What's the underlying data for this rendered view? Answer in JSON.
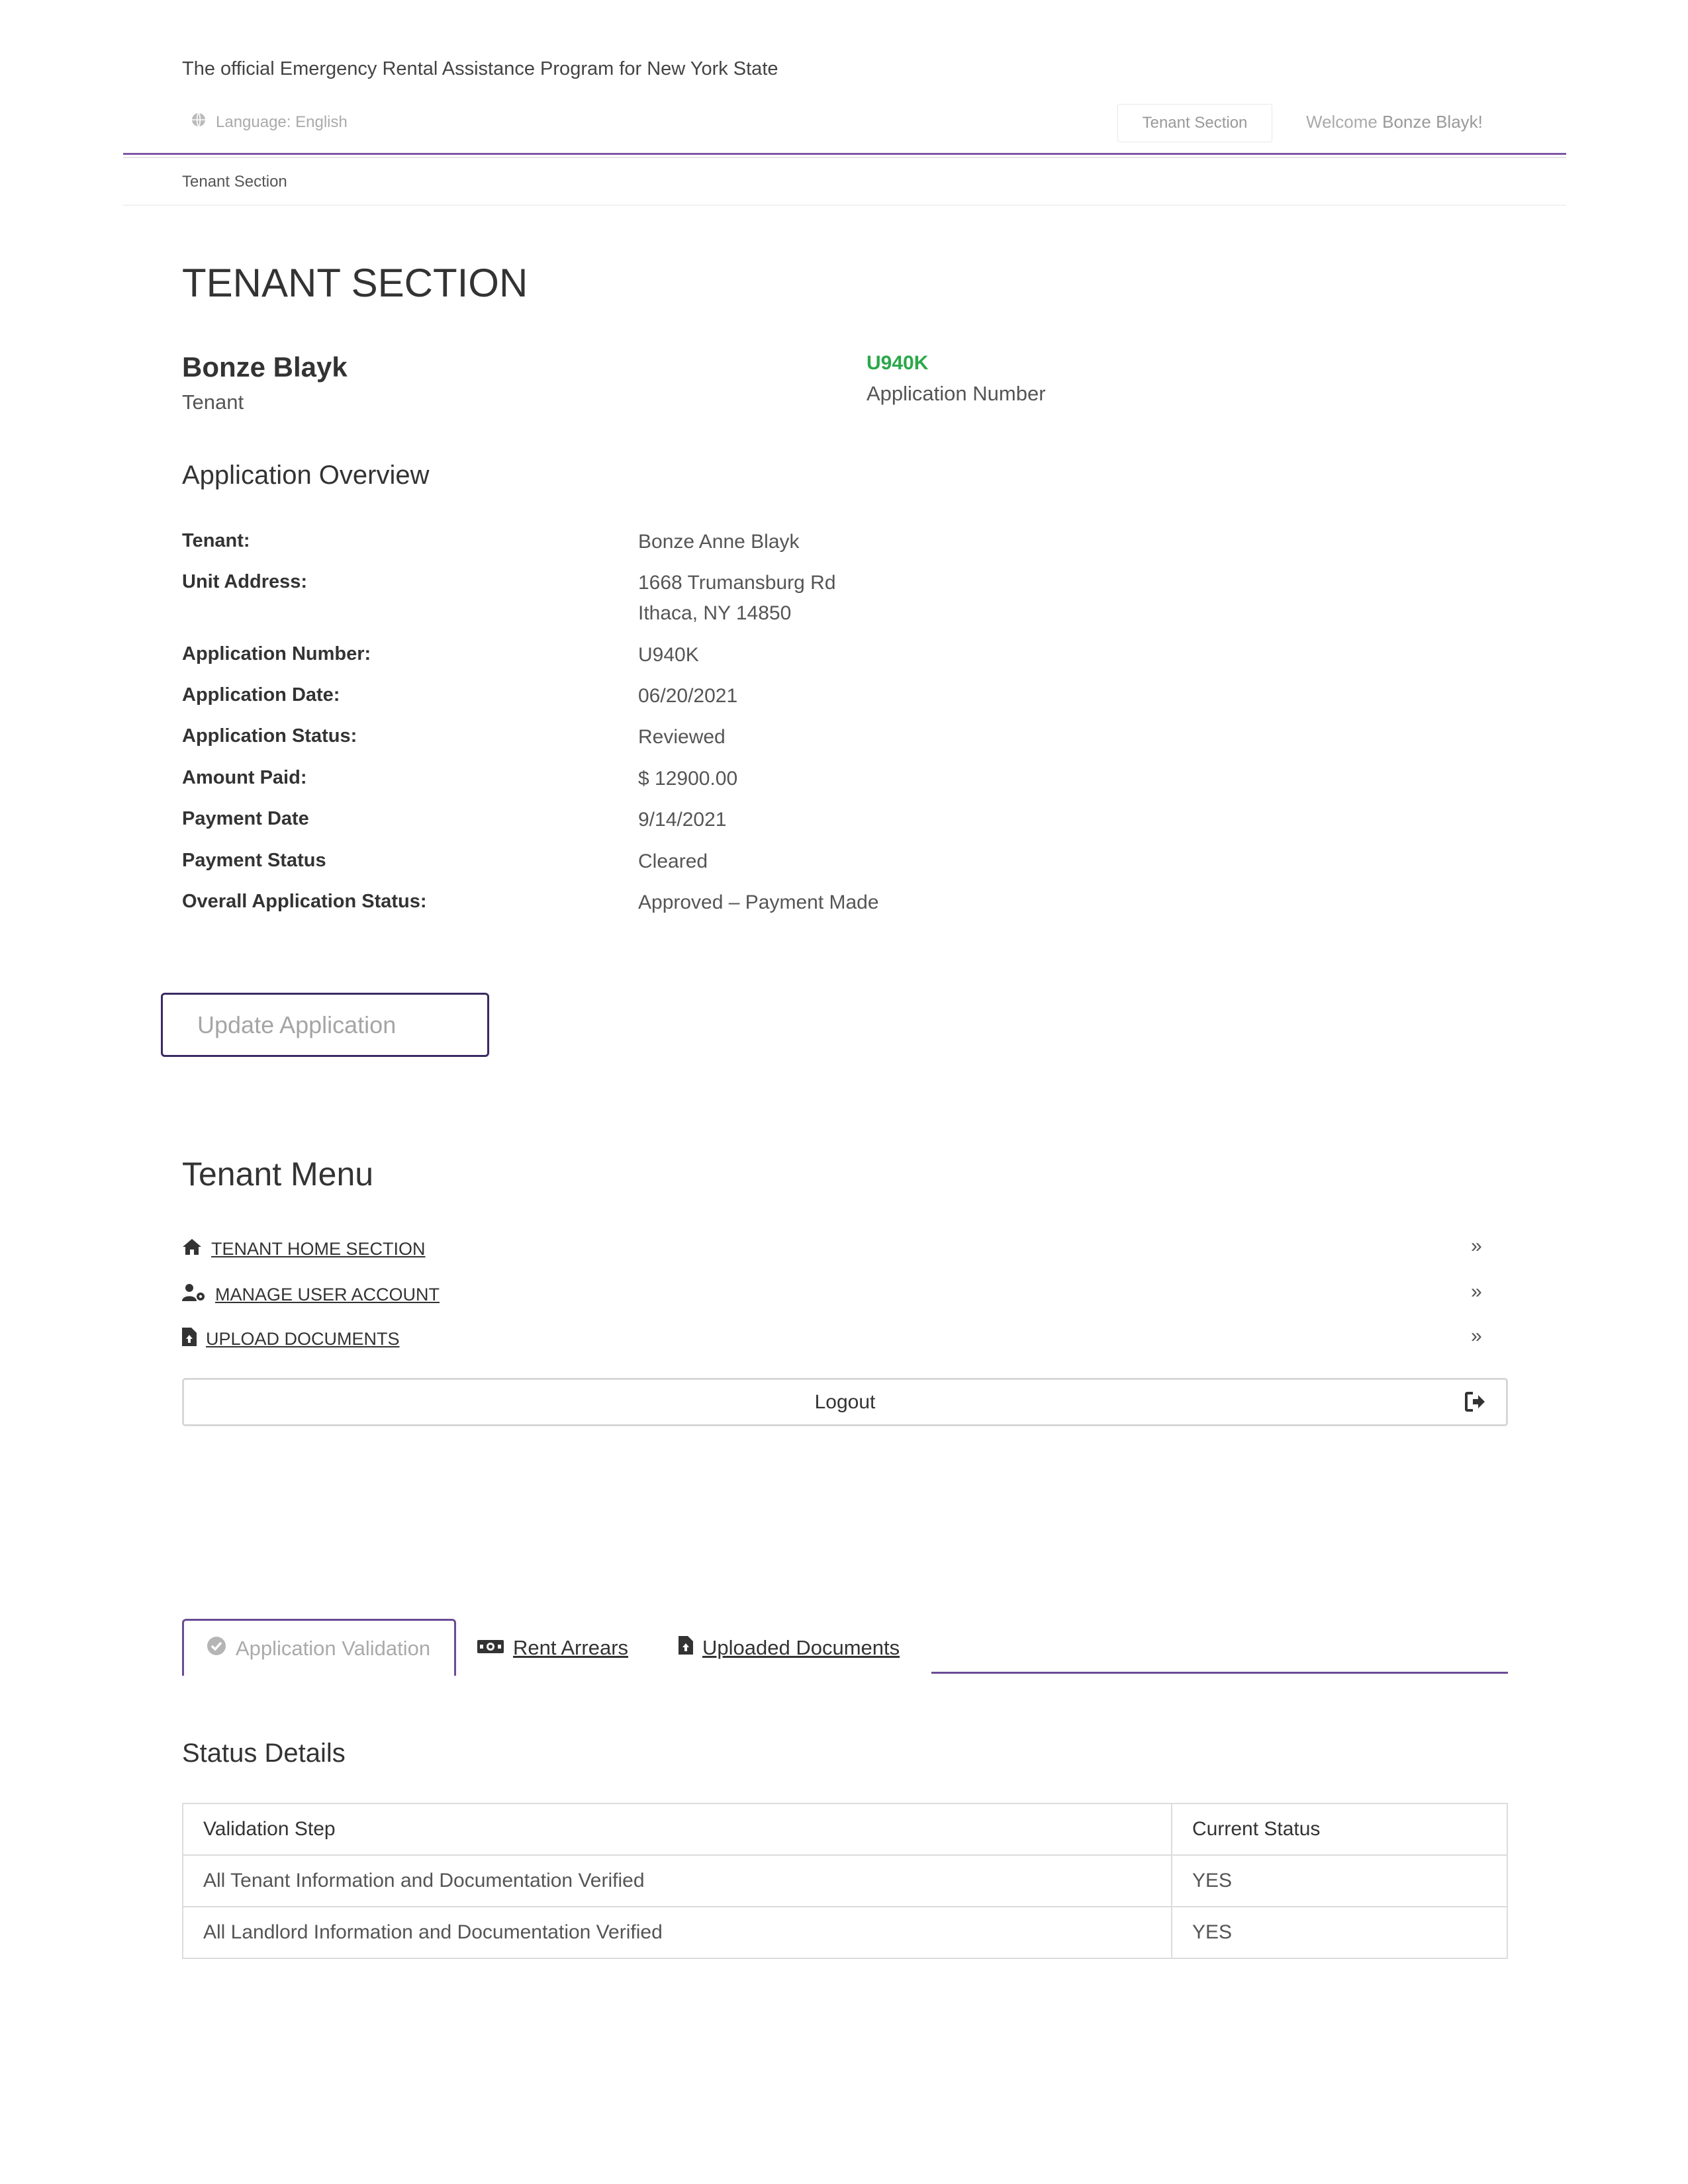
{
  "header": {
    "official_text": "The official Emergency Rental Assistance Program for New York State",
    "language": "Language: English",
    "tenant_section_button": "Tenant Section",
    "welcome_prefix": "Welcome",
    "welcome_name": "Bonze Blayk!"
  },
  "breadcrumb": "Tenant Section",
  "page_title": "TENANT SECTION",
  "user": {
    "name": "Bonze Blayk",
    "role": "Tenant"
  },
  "application": {
    "number": "U940K",
    "number_label": "Application Number"
  },
  "overview": {
    "title": "Application Overview",
    "rows": [
      {
        "label": "Tenant:",
        "value": "Bonze Anne Blayk"
      },
      {
        "label": "Unit Address:",
        "value": "1668 Trumansburg Rd",
        "value2": "Ithaca, NY 14850"
      },
      {
        "label": "Application Number:",
        "value": "U940K"
      },
      {
        "label": "Application Date:",
        "value": "06/20/2021"
      },
      {
        "label": "Application Status:",
        "value": "Reviewed"
      },
      {
        "label": "Amount Paid:",
        "value": "$ 12900.00"
      },
      {
        "label": "Payment Date",
        "value": "9/14/2021"
      },
      {
        "label": "Payment Status",
        "value": "Cleared"
      },
      {
        "label": "Overall Application Status:",
        "value": "Approved – Payment Made"
      }
    ]
  },
  "update_button": "Update Application",
  "menu": {
    "title": "Tenant Menu",
    "items": [
      {
        "label": " TENANT HOME SECTION",
        "icon": "home-icon"
      },
      {
        "label": " MANAGE USER ACCOUNT",
        "icon": "user-cog-icon"
      },
      {
        "label": " UPLOAD DOCUMENTS",
        "icon": "file-upload-icon"
      }
    ],
    "chevron": "»",
    "logout": "Logout"
  },
  "tabs": [
    {
      "label": "Application Validation",
      "icon": "check-circle-icon",
      "active": true
    },
    {
      "label": " Rent Arrears",
      "icon": "money-icon",
      "active": false
    },
    {
      "label": " Uploaded Documents",
      "icon": "file-upload-icon",
      "active": false
    }
  ],
  "status": {
    "title": "Status Details",
    "headers": [
      "Validation Step",
      "Current Status"
    ],
    "rows": [
      [
        "All Tenant Information and Documentation Verified",
        "YES"
      ],
      [
        "All Landlord Information and Documentation Verified",
        "YES"
      ]
    ]
  },
  "colors": {
    "accent": "#6b4b97",
    "app_number": "#2ba84a",
    "button_border": "#3a2a63"
  }
}
